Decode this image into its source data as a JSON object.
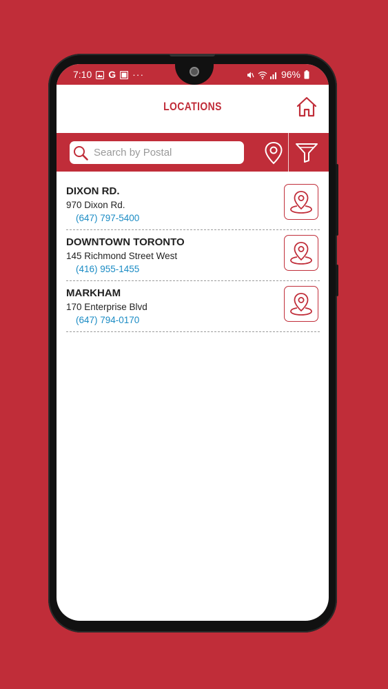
{
  "status_bar": {
    "time": "7:10",
    "left_glyphs": "G",
    "more": "···",
    "battery": "96%"
  },
  "header": {
    "title": "LOCATIONS"
  },
  "search": {
    "placeholder": "Search by Postal",
    "value": ""
  },
  "locations": [
    {
      "name": "DIXON RD.",
      "address": "970 Dixon Rd.",
      "phone": "(647) 797-5400"
    },
    {
      "name": "DOWNTOWN TORONTO",
      "address": "145 Richmond Street West",
      "phone": "(416) 955-1455"
    },
    {
      "name": "MARKHAM",
      "address": "170 Enterprise Blvd",
      "phone": "(647) 794-0170"
    }
  ],
  "colors": {
    "brand": "#c02d39",
    "phone_link": "#1a8bc4",
    "background": "#c02d39"
  },
  "icons": {
    "home": "home-icon",
    "search": "search-icon",
    "locate": "location-pin-icon",
    "filter": "filter-icon",
    "map": "map-pin-icon"
  }
}
